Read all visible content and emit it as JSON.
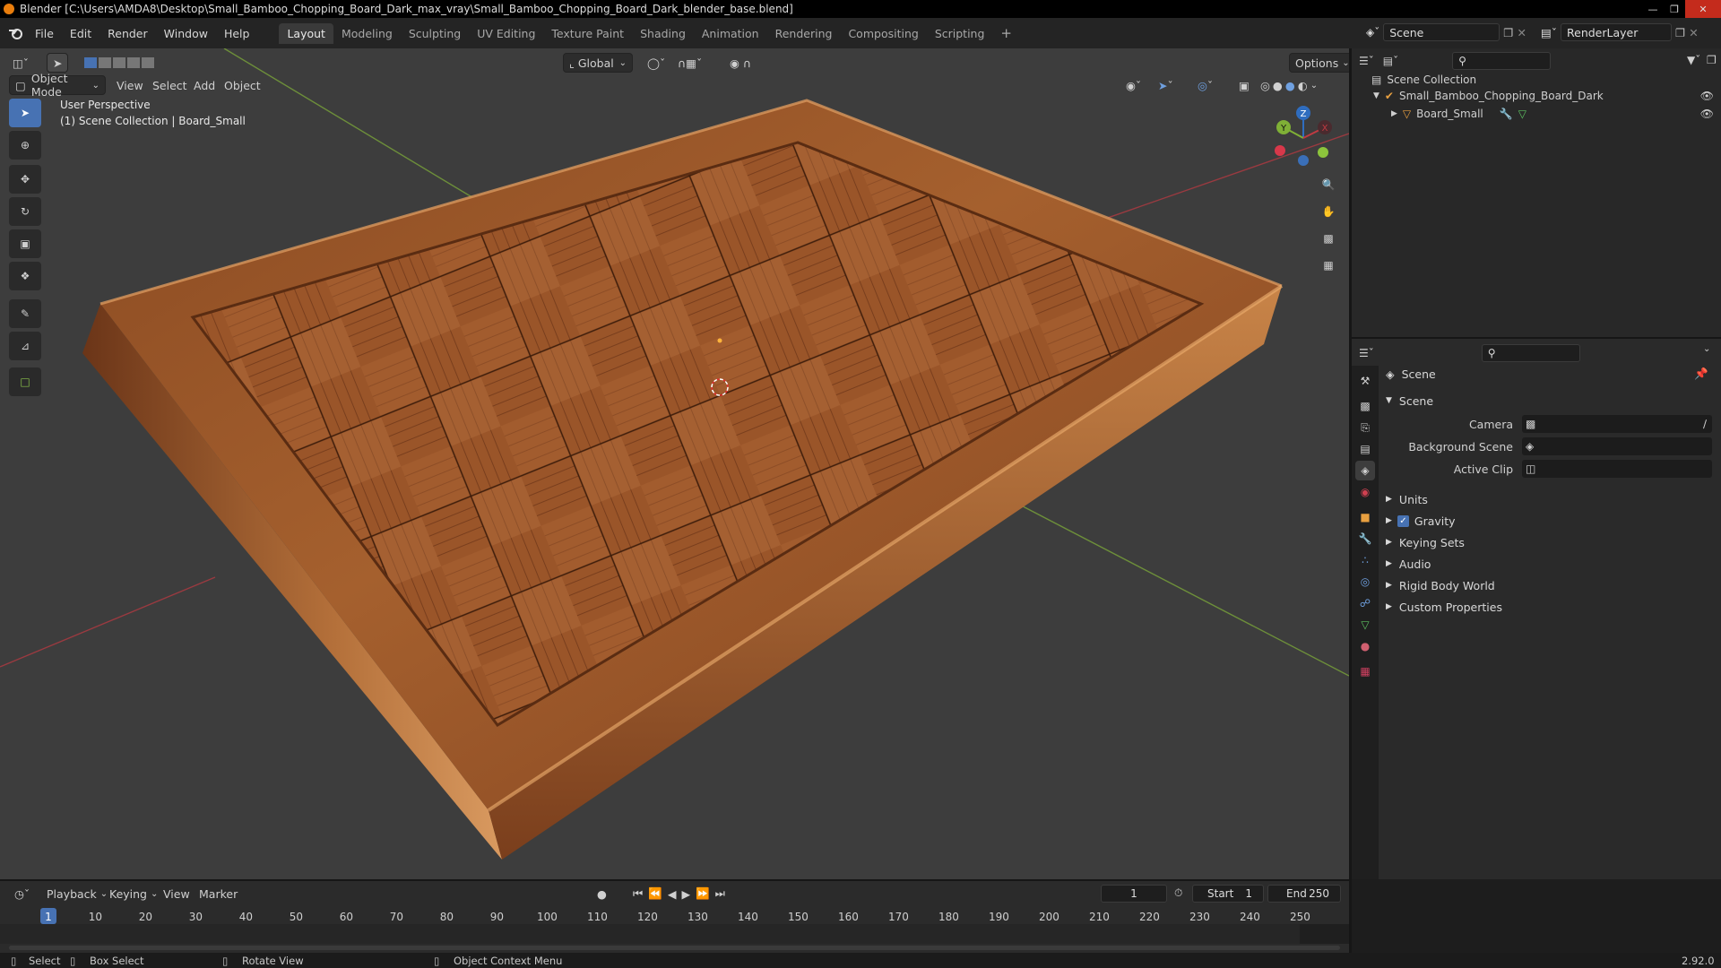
{
  "window": {
    "title": "Blender [C:\\Users\\AMDA8\\Desktop\\Small_Bamboo_Chopping_Board_Dark_max_vray\\Small_Bamboo_Chopping_Board_Dark_blender_base.blend]"
  },
  "menu": [
    "File",
    "Edit",
    "Render",
    "Window",
    "Help"
  ],
  "workspaces": [
    {
      "label": "Layout",
      "active": true
    },
    {
      "label": "Modeling"
    },
    {
      "label": "Sculpting"
    },
    {
      "label": "UV Editing"
    },
    {
      "label": "Texture Paint"
    },
    {
      "label": "Shading"
    },
    {
      "label": "Animation"
    },
    {
      "label": "Rendering"
    },
    {
      "label": "Compositing"
    },
    {
      "label": "Scripting"
    }
  ],
  "scene_selector": {
    "value": "Scene"
  },
  "viewlayer_selector": {
    "value": "RenderLayer"
  },
  "viewport": {
    "mode": "Object Mode",
    "menus": [
      "View",
      "Select",
      "Add",
      "Object"
    ],
    "orientation": "Global",
    "options_label": "Options",
    "overlay_line1": "User Perspective",
    "overlay_line2": "(1) Scene Collection | Board_Small",
    "gizmo": {
      "x": "X",
      "y": "Y",
      "z": "Z"
    }
  },
  "outliner": {
    "root": "Scene Collection",
    "items": [
      {
        "label": "Small_Bamboo_Chopping_Board_Dark",
        "level": 1
      },
      {
        "label": "Board_Small",
        "level": 2
      }
    ]
  },
  "properties": {
    "header": "Scene",
    "section": "Scene",
    "fields": [
      {
        "label": "Camera"
      },
      {
        "label": "Background Scene"
      },
      {
        "label": "Active Clip"
      }
    ],
    "panels": [
      {
        "label": "Units"
      },
      {
        "label": "Gravity",
        "checked": true
      },
      {
        "label": "Keying Sets"
      },
      {
        "label": "Audio"
      },
      {
        "label": "Rigid Body World"
      },
      {
        "label": "Custom Properties"
      }
    ]
  },
  "timeline": {
    "menus": [
      "Playback",
      "Keying",
      "View",
      "Marker"
    ],
    "current_frame": "1",
    "start_label": "Start",
    "start": "1",
    "end_label": "End",
    "end": "250",
    "ticks": [
      "1",
      "10",
      "20",
      "30",
      "40",
      "50",
      "60",
      "70",
      "80",
      "90",
      "100",
      "110",
      "120",
      "130",
      "140",
      "150",
      "160",
      "170",
      "180",
      "190",
      "200",
      "210",
      "220",
      "230",
      "240",
      "250"
    ]
  },
  "statusbar": {
    "select": "Select",
    "box_select": "Box Select",
    "rotate": "Rotate View",
    "context": "Object Context Menu",
    "version": "2.92.0"
  },
  "colors": {
    "accent": "#4772b3",
    "timeline_cursor": "#4772b3",
    "x_axis": "#c03a42",
    "y_axis": "#7fb036",
    "z_axis": "#2f6dbf"
  }
}
